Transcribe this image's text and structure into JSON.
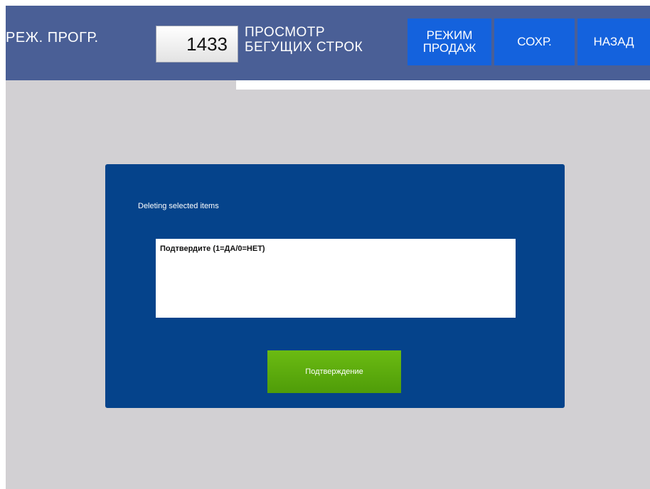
{
  "header": {
    "mode_label": "РЕЖ. ПРОГР.",
    "program_code": "1433",
    "screen_title": "ПРОСМОТР\nБЕГУЩИХ СТРОК",
    "buttons": {
      "sales_mode": "РЕЖИМ\nПРОДАЖ",
      "save": "СОХР.",
      "back": "НАЗАД"
    }
  },
  "dialog": {
    "message": "Deleting selected items",
    "prompt": "Подтвердите (1=ДА/0=НЕТ)",
    "confirm_label": "Подтверждение"
  },
  "colors": {
    "header_bg": "#4a5f96",
    "button_blue": "#1462dd",
    "dialog_bg": "#05438b",
    "confirm_green": "#5aa80d",
    "screen_bg": "#d2d0d3"
  }
}
